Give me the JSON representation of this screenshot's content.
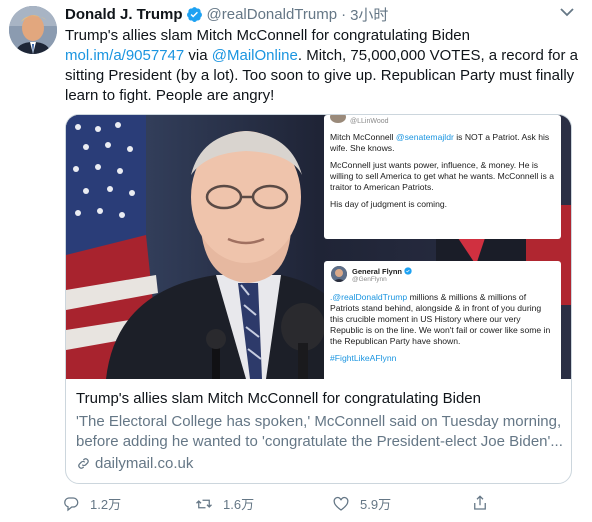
{
  "author": {
    "name": "Donald J. Trump",
    "handle": "@realDonaldTrump",
    "separator": "·",
    "time": "3小时"
  },
  "tweet": {
    "text_1": "Trump's allies slam Mitch McConnell for congratulating Biden ",
    "link_1": "mol.im/a/9057747",
    "text_2": " via ",
    "mention_1": "@MailOnline",
    "text_3": ". Mitch, 75,000,000 VOTES, a record for a sitting President (by a lot). Too soon to give up. Republican Party must finally learn to fight. People are angry!"
  },
  "card": {
    "overlay_top": {
      "handle": "@LLinWood",
      "p1_pre": "Mitch McConnell ",
      "p1_mention": "@senatemajldr",
      "p1_post": " is NOT a Patriot. Ask his wife. She knows.",
      "p2": "McConnell just wants power, influence, & money. He is willing to sell America to get what he wants. McConnell is a traitor to American Patriots.",
      "p3": "His day of judgment is coming."
    },
    "overlay_bottom": {
      "name": "General Flynn",
      "handle": "@GenFlynn",
      "mention": ".@realDonaldTrump",
      "body": " millions & millions & millions of Patriots stand behind, alongside & in front of you during this crucible moment in US History where our very Republic is on the line. We won't fail or cower like some in the Republican Party have shown.",
      "hashtag": "#FightLikeAFlynn"
    },
    "title": "Trump's allies slam Mitch McConnell for congratulating Biden",
    "desc_line_1": "'The Electoral College has spoken,' McConnell said on Tuesday morning,",
    "desc_line_2": "before adding he wanted to 'congratulate the President-elect Joe Biden'...",
    "domain": "dailymail.co.uk"
  },
  "actions": {
    "reply_count": "1.2万",
    "retweet_count": "1.6万",
    "like_count": "5.9万",
    "icons": [
      "reply-icon",
      "retweet-icon",
      "like-icon",
      "share-icon"
    ]
  },
  "colors": {
    "link": "#1b95e0",
    "secondary_text": "#657786",
    "verified": "#1da1f2"
  }
}
